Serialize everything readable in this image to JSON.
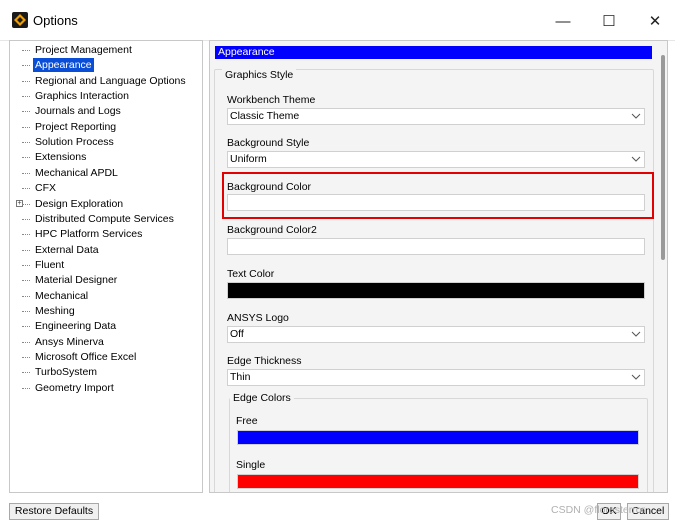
{
  "window": {
    "title": "Options",
    "minimize_glyph": "—",
    "maximize_glyph": "☐",
    "close_glyph": "✕"
  },
  "tree": {
    "items": [
      {
        "label": "Project Management",
        "expandable": false,
        "selected": false
      },
      {
        "label": "Appearance",
        "expandable": false,
        "selected": true
      },
      {
        "label": "Regional and Language Options",
        "expandable": false,
        "selected": false
      },
      {
        "label": "Graphics Interaction",
        "expandable": false,
        "selected": false
      },
      {
        "label": "Journals and Logs",
        "expandable": false,
        "selected": false
      },
      {
        "label": "Project Reporting",
        "expandable": false,
        "selected": false
      },
      {
        "label": "Solution Process",
        "expandable": false,
        "selected": false
      },
      {
        "label": "Extensions",
        "expandable": false,
        "selected": false
      },
      {
        "label": "Mechanical APDL",
        "expandable": false,
        "selected": false
      },
      {
        "label": "CFX",
        "expandable": false,
        "selected": false
      },
      {
        "label": "Design Exploration",
        "expandable": true,
        "selected": false
      },
      {
        "label": "Distributed Compute Services",
        "expandable": false,
        "selected": false
      },
      {
        "label": "HPC Platform Services",
        "expandable": false,
        "selected": false
      },
      {
        "label": "External Data",
        "expandable": false,
        "selected": false
      },
      {
        "label": "Fluent",
        "expandable": false,
        "selected": false
      },
      {
        "label": "Material Designer",
        "expandable": false,
        "selected": false
      },
      {
        "label": "Mechanical",
        "expandable": false,
        "selected": false
      },
      {
        "label": "Meshing",
        "expandable": false,
        "selected": false
      },
      {
        "label": "Engineering Data",
        "expandable": false,
        "selected": false
      },
      {
        "label": "Ansys Minerva",
        "expandable": false,
        "selected": false
      },
      {
        "label": "Microsoft Office Excel",
        "expandable": false,
        "selected": false
      },
      {
        "label": "TurboSystem",
        "expandable": false,
        "selected": false
      },
      {
        "label": "Geometry Import",
        "expandable": false,
        "selected": false
      }
    ]
  },
  "panel": {
    "header": "Appearance",
    "group_title": "Graphics Style",
    "workbench_theme": {
      "label": "Workbench Theme",
      "value": "Classic Theme"
    },
    "background_style": {
      "label": "Background Style",
      "value": "Uniform"
    },
    "background_color": {
      "label": "Background Color",
      "value": "",
      "color": "#ffffff"
    },
    "background_color2": {
      "label": "Background Color2",
      "value": "",
      "color": "#ffffff"
    },
    "text_color": {
      "label": "Text Color",
      "color": "#000000"
    },
    "ansys_logo": {
      "label": "ANSYS Logo",
      "value": "Off"
    },
    "edge_thickness": {
      "label": "Edge Thickness",
      "value": "Thin"
    },
    "edge_colors": {
      "title": "Edge Colors",
      "free": {
        "label": "Free",
        "color": "#0000ff"
      },
      "single": {
        "label": "Single",
        "color": "#ff0000"
      }
    },
    "highlight_color": "#e30000",
    "selection_color": "#0a4ed8"
  },
  "footer": {
    "restore_defaults": "Restore Defaults",
    "ok": "OK",
    "cancel": "Cancel",
    "watermark": "CSDN @floresterror"
  }
}
